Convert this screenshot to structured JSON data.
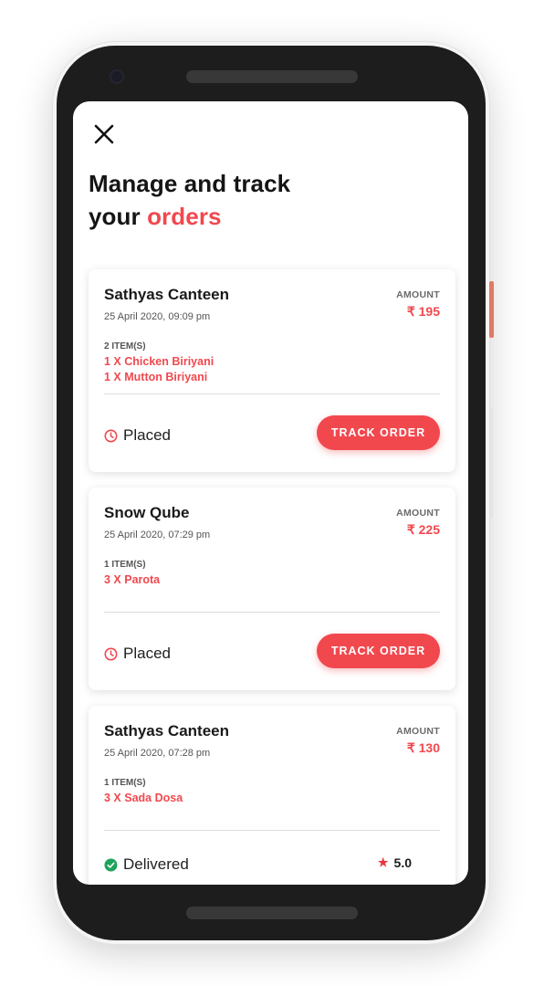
{
  "header": {
    "title_line1": "Manage and track",
    "title_line2_prefix": "your",
    "title_line2_accent": "orders"
  },
  "labels": {
    "amount": "AMOUNT",
    "currency": "₹",
    "track_order": "TRACK ORDER"
  },
  "colors": {
    "accent": "#f1484e",
    "delivered": "#1ea35a",
    "text_dark": "#1a1a1a"
  },
  "orders": [
    {
      "restaurant": "Sathyas Canteen",
      "datetime": "25 April 2020, 09:09 pm",
      "amount": "195",
      "items_count": "2 ITEM(S)",
      "items": [
        "1 X Chicken Biriyani",
        "1 X Mutton Biriyani"
      ],
      "status": "Placed",
      "status_icon": "clock-icon",
      "action": "TRACK ORDER"
    },
    {
      "restaurant": "Snow Qube",
      "datetime": "25 April 2020, 07:29 pm",
      "amount": "225",
      "items_count": "1 ITEM(S)",
      "items": [
        "3 X Parota"
      ],
      "status": "Placed",
      "status_icon": "clock-icon",
      "action": "TRACK ORDER"
    },
    {
      "restaurant": "Sathyas Canteen",
      "datetime": "25 April 2020, 07:28 pm",
      "amount": "130",
      "items_count": "1 ITEM(S)",
      "items": [
        "3 X Sada Dosa"
      ],
      "status": "Delivered",
      "status_icon": "check-circle-icon",
      "rating": "5.0"
    }
  ]
}
